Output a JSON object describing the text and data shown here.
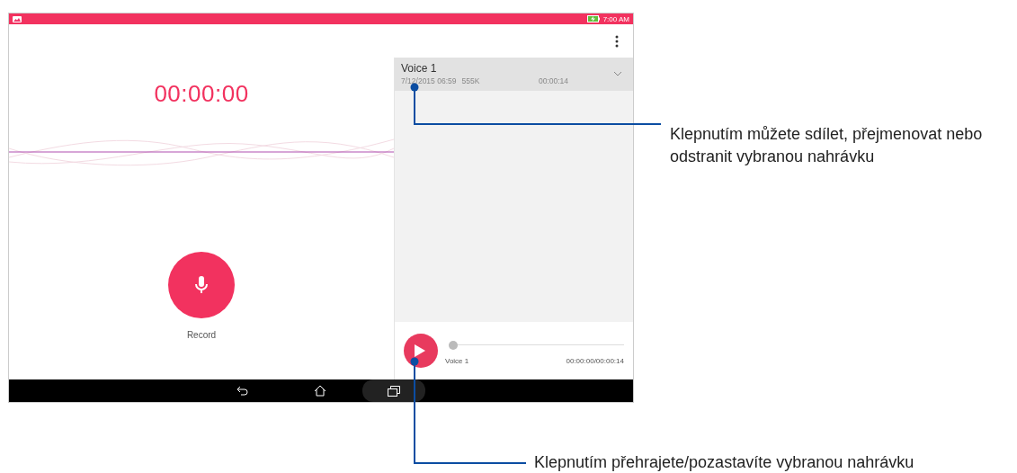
{
  "status_bar": {
    "time": "7:00 AM"
  },
  "recorder": {
    "timer": "00:00:00",
    "record_label": "Record"
  },
  "recordings": [
    {
      "name": "Voice 1",
      "date": "7/12/2015 06:59",
      "size": "555K",
      "duration": "00:00:14",
      "selected": true
    }
  ],
  "player": {
    "name": "Voice 1",
    "time": "00:00:00/00:00:14",
    "level": 0
  },
  "callouts": [
    {
      "text": "Klepnutím můžete sdílet, přejmenovat nebo odstranit vybranou nahrávku"
    },
    {
      "text": "Klepnutím přehrajete/pozastavíte vybranou nahrávku"
    }
  ]
}
